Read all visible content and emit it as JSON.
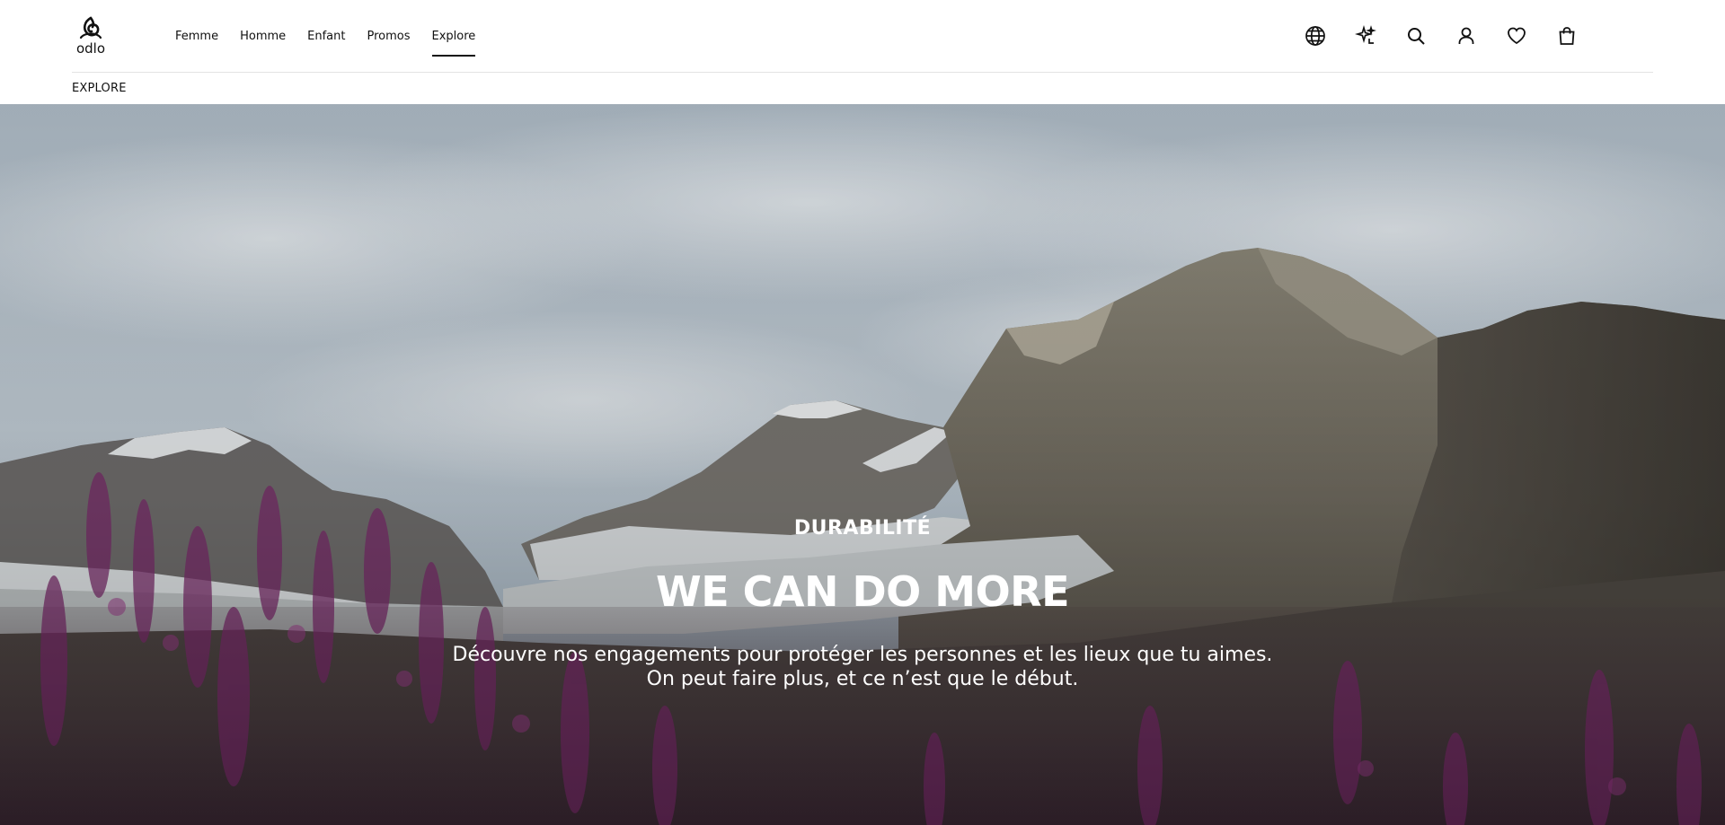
{
  "brand": {
    "logo_text": "odlo"
  },
  "nav": {
    "items": [
      {
        "label": "Femme",
        "active": false
      },
      {
        "label": "Homme",
        "active": false
      },
      {
        "label": "Enfant",
        "active": false
      },
      {
        "label": "Promos",
        "active": false
      },
      {
        "label": "Explore",
        "active": true
      }
    ]
  },
  "header_icons": [
    "globe-icon",
    "ai-sparkle-icon",
    "search-icon",
    "account-icon",
    "wishlist-heart-icon",
    "shopping-bag-icon"
  ],
  "breadcrumb": {
    "label": "EXPLORE"
  },
  "hero": {
    "kicker": "DURABILITÉ",
    "headline": "WE CAN DO MORE",
    "description_line1": "Découvre nos engagements pour protéger les personnes et les lieux que tu aimes.",
    "description_line2": "On peut faire plus, et ce n’est que le début.",
    "colors": {
      "sky": "#b9c6d1",
      "rock": "#6e6a5f",
      "flowers": "#7a2b6b",
      "text": "#ffffff"
    }
  }
}
